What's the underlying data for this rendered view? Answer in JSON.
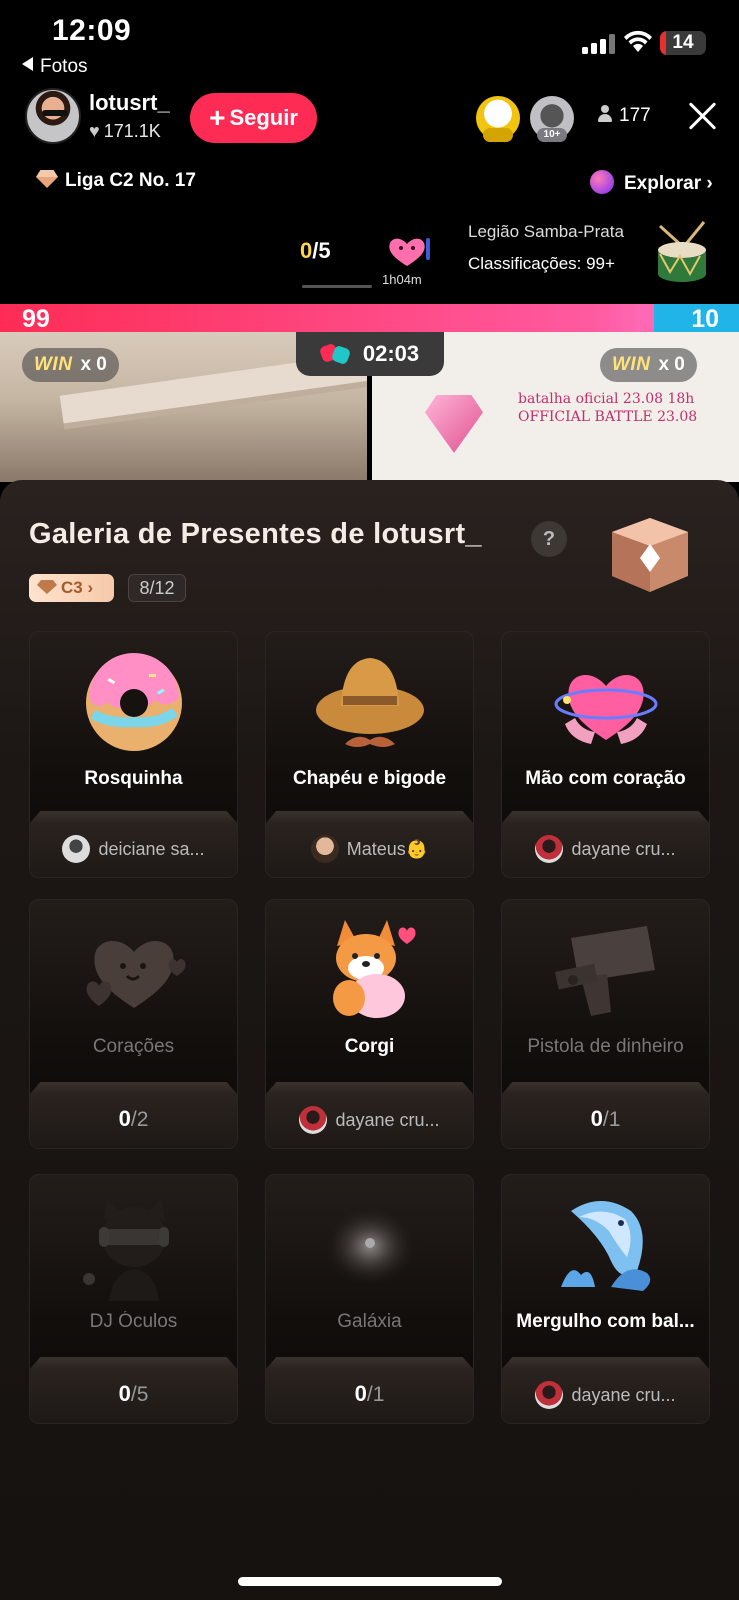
{
  "status_bar": {
    "time": "12:09",
    "back_app": "Fotos",
    "battery": "14"
  },
  "host": {
    "name": "lotusrt_",
    "likes": "171.1K",
    "follow_label": "Seguir"
  },
  "viewers": {
    "badge1": "",
    "badge2": "10+",
    "count": "177"
  },
  "league": {
    "label": "Liga C2 No. 17",
    "explore_label": "Explorar"
  },
  "goal": {
    "current": "0",
    "total": "/5",
    "gift_timer": "1h04m"
  },
  "legion": {
    "name": "Legião Samba-Prata",
    "rank": "Classificações: 99+"
  },
  "pk": {
    "left_score": "99",
    "right_score": "10",
    "timer": "02:03",
    "win_word": "WIN",
    "left_wins": "x 0",
    "right_wins": "x 0",
    "share_fraction": 0.885
  },
  "stream_overlay": {
    "line1": "batalha oficial 23.08 18h",
    "line2": "OFFICIAL BATTLE 23.08"
  },
  "gallery": {
    "title": "Galeria de Presentes de lotusrt_",
    "help": "?",
    "level": "C3",
    "progress": "8/12",
    "cards": [
      {
        "name": "Rosquinha",
        "donor": "deiciane sa...",
        "locked": false
      },
      {
        "name": "Chapéu e bigode",
        "donor": "Mateus👶",
        "locked": false
      },
      {
        "name": "Mão com coração",
        "donor": "dayane cru...",
        "locked": false
      },
      {
        "name": "Corações",
        "have": "0",
        "need": "/2",
        "locked": true
      },
      {
        "name": "Corgi",
        "donor": "dayane cru...",
        "locked": false
      },
      {
        "name": "Pistola de dinheiro",
        "have": "0",
        "need": "/1",
        "locked": true
      },
      {
        "name": "DJ Óculos",
        "have": "0",
        "need": "/5",
        "locked": true
      },
      {
        "name": "Galáxia",
        "have": "0",
        "need": "/1",
        "locked": true
      },
      {
        "name": "Mergulho com bal...",
        "donor": "dayane cru...",
        "locked": false
      }
    ]
  },
  "colors": {
    "accent": "#fe2c55",
    "blue_team": "#20b4e8",
    "gold": "#ffd54a"
  }
}
